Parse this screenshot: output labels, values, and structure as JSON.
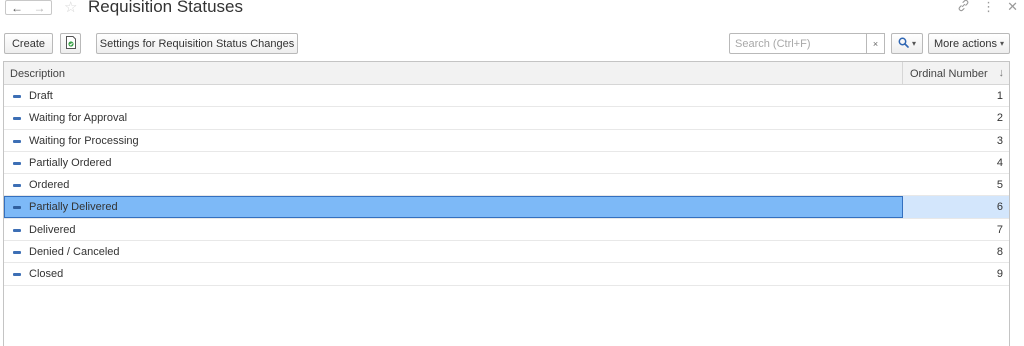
{
  "window": {
    "title": "Requisition Statuses"
  },
  "toolbar": {
    "create_label": "Create",
    "settings_label": "Settings for Requisition Status Changes",
    "search_placeholder": "Search (Ctrl+F)",
    "clear_label": "×",
    "more_actions_label": "More actions"
  },
  "table": {
    "columns": {
      "description": "Description",
      "ordinal": "Ordinal Number"
    },
    "rows": [
      {
        "description": "Draft",
        "ordinal": "1"
      },
      {
        "description": "Waiting for Approval",
        "ordinal": "2"
      },
      {
        "description": "Waiting for Processing",
        "ordinal": "3"
      },
      {
        "description": "Partially Ordered",
        "ordinal": "4"
      },
      {
        "description": "Ordered",
        "ordinal": "5"
      },
      {
        "description": "Partially Delivered",
        "ordinal": "6"
      },
      {
        "description": "Delivered",
        "ordinal": "7"
      },
      {
        "description": "Denied / Canceled",
        "ordinal": "8"
      },
      {
        "description": "Closed",
        "ordinal": "9"
      }
    ],
    "selected_index": 5
  },
  "icons": {
    "back": "arrow-left-icon",
    "forward": "arrow-right-icon",
    "favorite": "star-icon",
    "link": "link-icon",
    "menu": "more-vertical-icon",
    "close": "close-icon",
    "save": "save-document-icon",
    "search": "search-icon",
    "sort": "sort-arrow-down-icon",
    "row_marker": "dash-icon"
  },
  "colors": {
    "selected_row": "#7db9f7",
    "selected_row_border": "#3470bf",
    "selected_cell": "#d3e6fc",
    "accent": "#3d6fb5",
    "save_icon": "#3aa047"
  }
}
